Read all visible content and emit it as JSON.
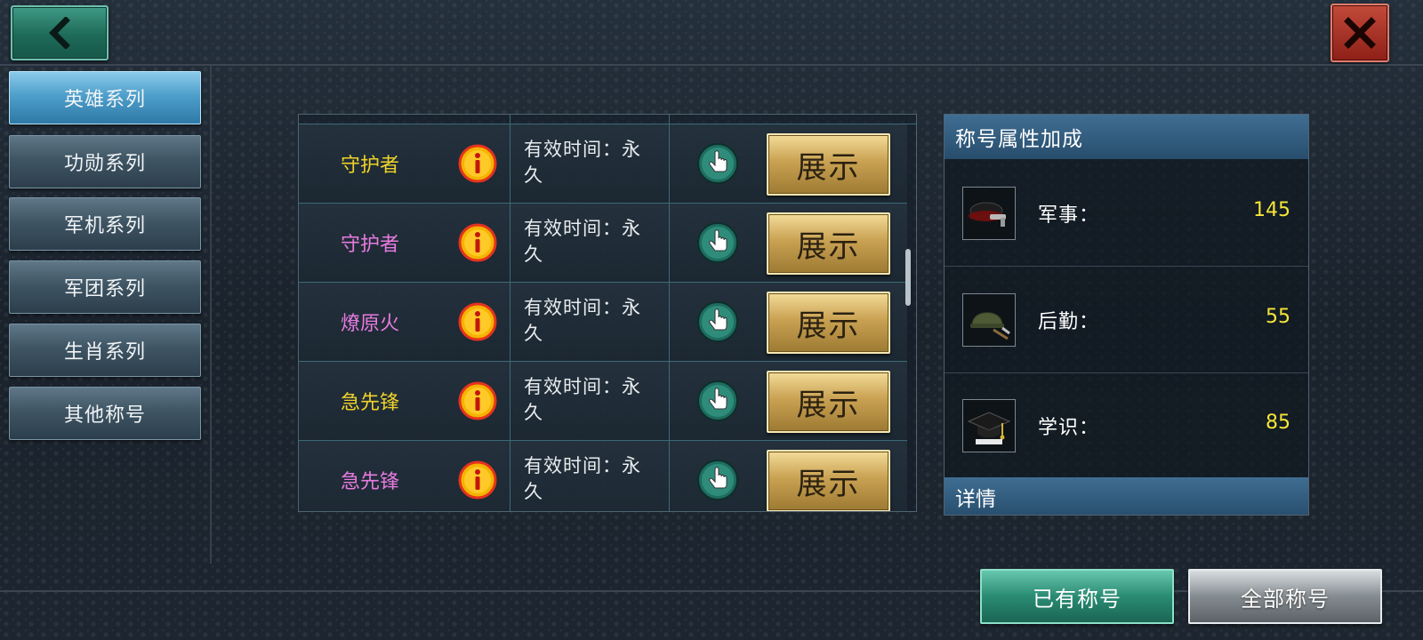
{
  "sidebar": {
    "items": [
      {
        "label": "英雄系列",
        "active": true
      },
      {
        "label": "功勋系列",
        "active": false
      },
      {
        "label": "军机系列",
        "active": false
      },
      {
        "label": "军团系列",
        "active": false
      },
      {
        "label": "生肖系列",
        "active": false
      },
      {
        "label": "其他称号",
        "active": false
      }
    ]
  },
  "titles": {
    "rows": [
      {
        "name": "守护者",
        "name_color": "#f0d22a",
        "time_line1": "有效时间：永",
        "time_line2": "久",
        "show_label": "展示"
      },
      {
        "name": "守护者",
        "name_color": "#e77be0",
        "time_line1": "有效时间：永",
        "time_line2": "久",
        "show_label": "展示"
      },
      {
        "name": "燎原火",
        "name_color": "#e77be0",
        "time_line1": "有效时间：永",
        "time_line2": "久",
        "show_label": "展示"
      },
      {
        "name": "急先锋",
        "name_color": "#f0d22a",
        "time_line1": "有效时间：永",
        "time_line2": "久",
        "show_label": "展示"
      },
      {
        "name": "急先锋",
        "name_color": "#e77be0",
        "time_line1": "有效时间：永",
        "time_line2": "久",
        "show_label": "展示"
      }
    ]
  },
  "attributes": {
    "header": "称号属性加成",
    "items": [
      {
        "icon": "military-hat-icon",
        "label": "军事：",
        "value": "145"
      },
      {
        "icon": "helmet-pickaxe-icon",
        "label": "后勤：",
        "value": "55"
      },
      {
        "icon": "graduation-cap-icon",
        "label": "学识：",
        "value": "85"
      }
    ],
    "details_header": "详情"
  },
  "bottom": {
    "owned_label": "已有称号",
    "all_label": "全部称号"
  },
  "colors": {
    "value_yellow": "#f5e538",
    "name_gold": "#f0d22a",
    "name_pink": "#e77be0"
  }
}
